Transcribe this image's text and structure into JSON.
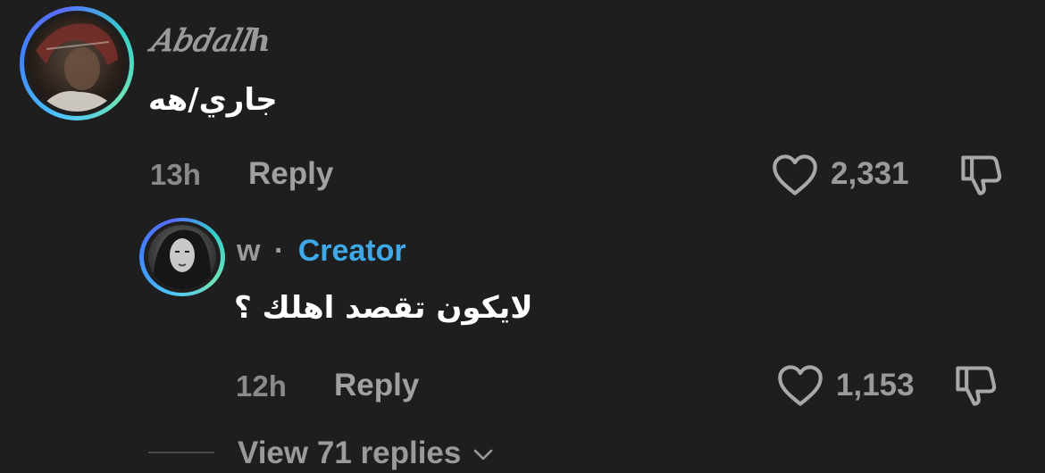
{
  "comments": [
    {
      "username": "𝐴𝑏𝑑𝑎𝑙𝑙ℎ",
      "text": "جاري/هه",
      "time": "13h",
      "reply_label": "Reply",
      "likes": "2,331"
    },
    {
      "username": "w",
      "separator": "·",
      "badge": "Creator",
      "text": "لايكون تقصد اهلك ؟",
      "time": "12h",
      "reply_label": "Reply",
      "likes": "1,153"
    }
  ],
  "view_replies": "View 71 replies",
  "icons": {
    "like": "heart-outline-icon",
    "dislike": "thumbs-down-icon",
    "expand": "chevron-down-icon"
  },
  "colors": {
    "background": "#1e1e1e",
    "creator_badge": "#3fa9e8",
    "muted_text": "#9a9a9a"
  }
}
